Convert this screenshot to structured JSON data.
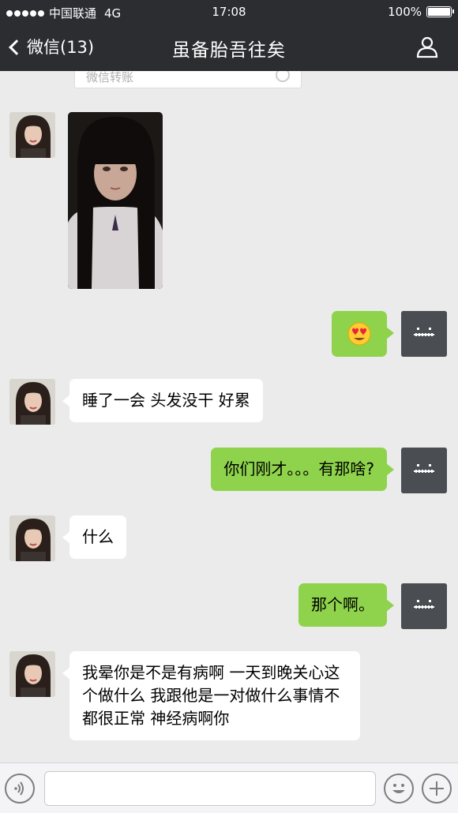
{
  "status_bar": {
    "carrier": "中国联通",
    "network": "4G",
    "time": "17:08",
    "battery": "100%",
    "battery_level": 1.0
  },
  "nav": {
    "back_label": "微信(13)",
    "title": "虽备胎吾往矣",
    "back_icon": "chevron-left-icon",
    "profile_icon": "person-icon"
  },
  "chat": {
    "transfer_label": "微信转账",
    "messages": [
      {
        "from": "other",
        "type": "image"
      },
      {
        "from": "me",
        "type": "emoji",
        "text": "😍"
      },
      {
        "from": "other",
        "type": "text",
        "text": "睡了一会 头发没干 好累"
      },
      {
        "from": "me",
        "type": "text",
        "text": "你们刚才。。。有那啥?"
      },
      {
        "from": "other",
        "type": "text",
        "text": "什么"
      },
      {
        "from": "me",
        "type": "text",
        "text": "那个啊。"
      },
      {
        "from": "other",
        "type": "text",
        "text": "我晕你是不是有病啊 一天到晚关心这个做什么 我跟他是一对做什么事情不都很正常 神经病啊你"
      }
    ]
  },
  "input_bar": {
    "placeholder": "",
    "voice_icon": "voice-icon",
    "emoji_icon": "smiley-icon",
    "plus_icon": "plus-icon"
  },
  "colors": {
    "nav_bg": "#2b2d31",
    "chat_bg": "#ebebeb",
    "my_bubble": "#8ed34b",
    "their_bubble": "#ffffff"
  }
}
